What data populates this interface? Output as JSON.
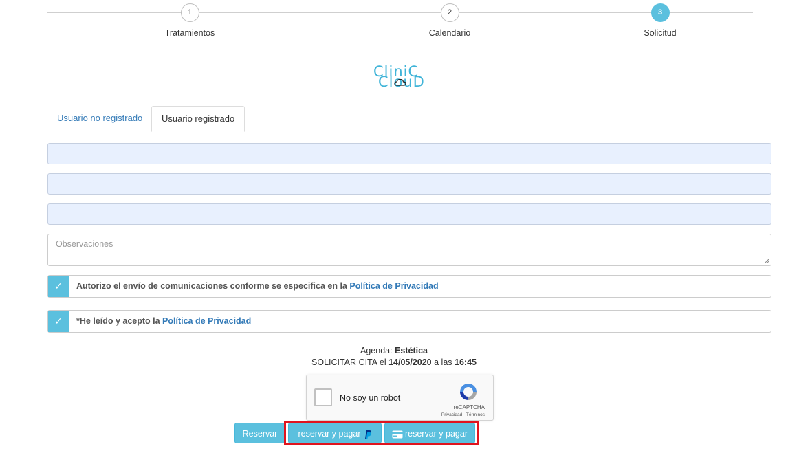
{
  "stepper": {
    "steps": [
      {
        "number": "1",
        "label": "Tratamientos"
      },
      {
        "number": "2",
        "label": "Calendario"
      },
      {
        "number": "3",
        "label": "Solicitud"
      }
    ]
  },
  "logo": {
    "line1": "CliniC",
    "line2": "ClouD"
  },
  "tabs": [
    {
      "label": "Usuario no registrado"
    },
    {
      "label": "Usuario registrado"
    }
  ],
  "form": {
    "observations_placeholder": "Observaciones",
    "consent_comms": {
      "checked_glyph": "✓",
      "text": "Autorizo el envío de comunicaciones conforme se especifica en la ",
      "link": "Política de Privacidad"
    },
    "consent_privacy": {
      "checked_glyph": "✓",
      "text": "*He leído y acepto la ",
      "link": "Política de Privacidad"
    }
  },
  "summary": {
    "agenda_label": "Agenda: ",
    "agenda_value": "Estética",
    "request_label": "SOLICITAR CITA el ",
    "date": "14/05/2020",
    "at_label": " a las ",
    "time": "16:45"
  },
  "captcha": {
    "label": "No soy un robot",
    "brand": "reCAPTCHA",
    "terms": "Privacidad - Términos"
  },
  "buttons": {
    "reservar": "Reservar",
    "paypal": "reservar y pagar",
    "card": "reservar y pagar"
  },
  "colors": {
    "accent": "#5bc0de",
    "link": "#337ab7",
    "highlight": "#e0141e"
  },
  "icons": {
    "paypal": "paypal-icon",
    "card": "credit-card-icon",
    "captcha": "recaptcha-icon"
  }
}
